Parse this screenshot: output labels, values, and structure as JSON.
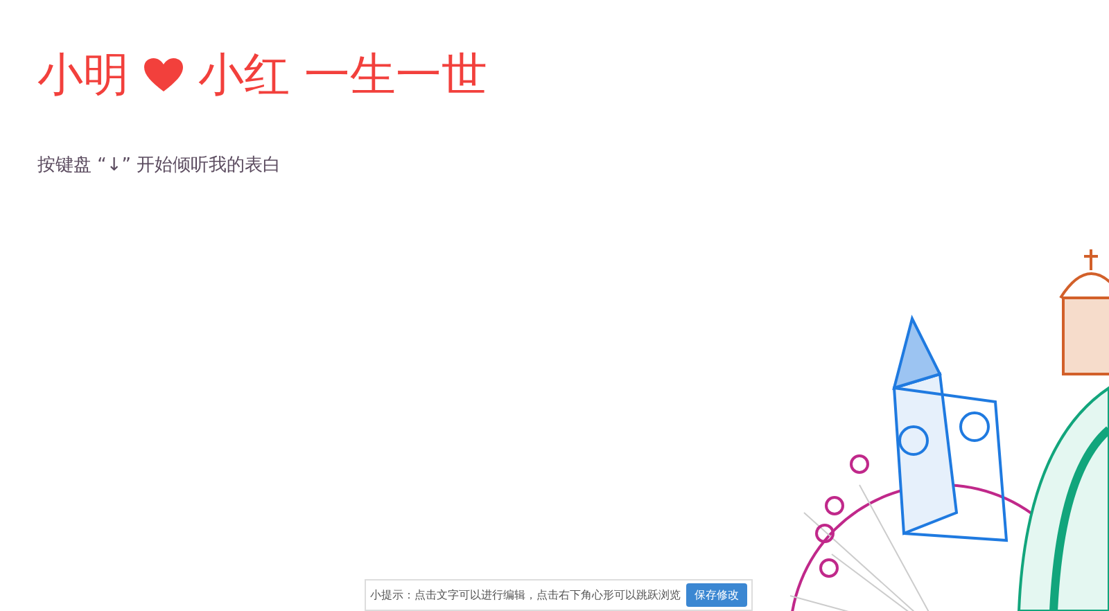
{
  "title": {
    "from": "小明",
    "to": "小红 一生一世"
  },
  "prompt": "按键盘 “↓” 开始倾听我的表白",
  "tip_bar": {
    "text": "小提示：点击文字可以进行编辑，点击右下角心形可以跳跃浏览",
    "button": "保存修改"
  }
}
